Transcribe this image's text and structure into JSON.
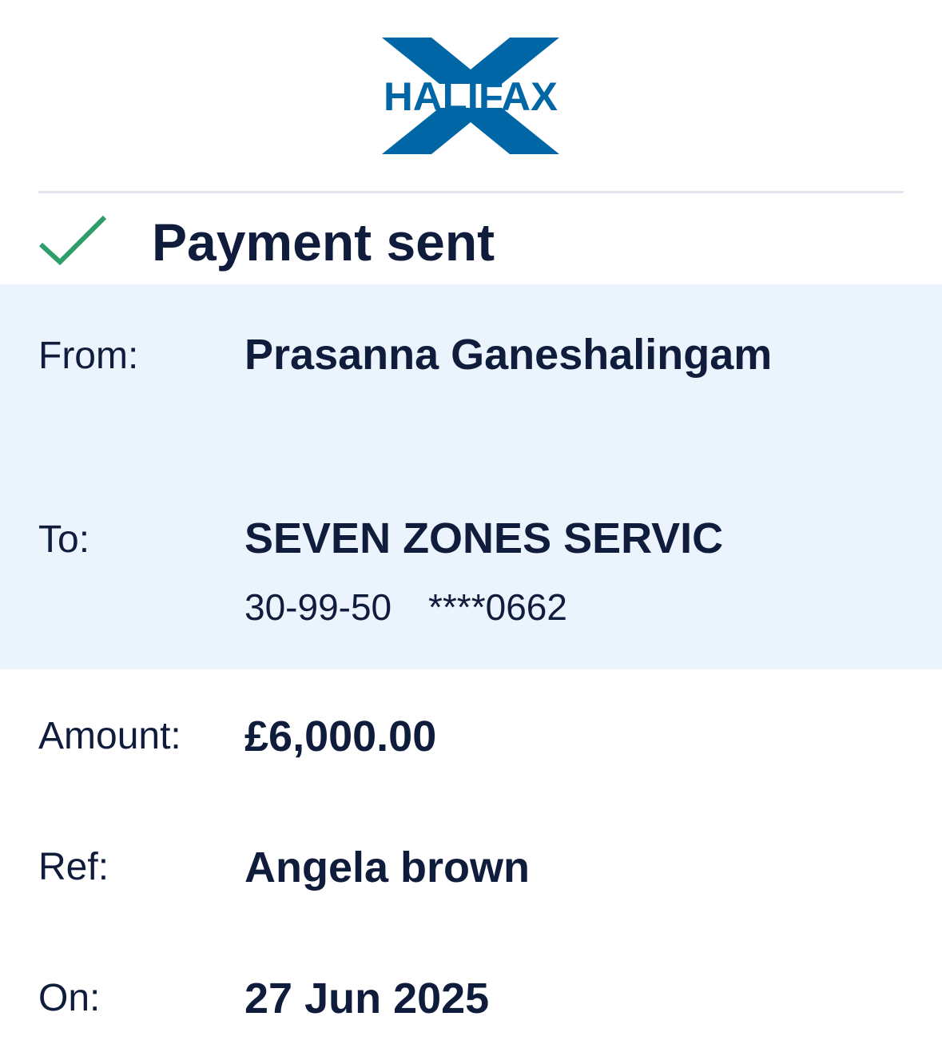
{
  "brand": {
    "name": "HALIFAX",
    "color": "#0066a5"
  },
  "status": {
    "icon": "check-icon",
    "title": "Payment sent",
    "check_color": "#2e9e6a"
  },
  "details": {
    "from": {
      "label": "From:",
      "value": "Prasanna Ganeshalingam"
    },
    "to": {
      "label": "To:",
      "value": "SEVEN ZONES SERVIC",
      "sort_code": "30-99-50",
      "account_number": "****0662"
    },
    "amount": {
      "label": "Amount:",
      "value": "£6,000.00"
    },
    "ref": {
      "label": "Ref:",
      "value": "Angela brown"
    },
    "on": {
      "label": "On:",
      "value": "27 Jun 2025"
    }
  },
  "colors": {
    "text": "#0f1c3c",
    "highlight_bg": "#ebf3fd",
    "divider": "#e3e6ee"
  }
}
